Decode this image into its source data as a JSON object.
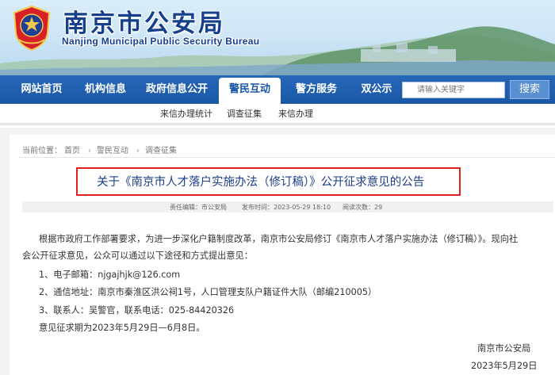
{
  "header": {
    "title_cn": "南京市公安局",
    "title_en": "Nanjing Municipal Public Security Bureau",
    "emblem_icon": "police-emblem-icon"
  },
  "nav": {
    "items": [
      {
        "label": "网站首页",
        "active": false
      },
      {
        "label": "机构信息",
        "active": false
      },
      {
        "label": "政府信息公开",
        "active": false
      },
      {
        "label": "警民互动",
        "active": true
      },
      {
        "label": "警方服务",
        "active": false
      },
      {
        "label": "双公示",
        "active": false
      }
    ],
    "search_placeholder": "请输入关键字",
    "search_button": "搜索"
  },
  "subnav": {
    "items": [
      "来信办理统计",
      "调查征集",
      "来信办理"
    ]
  },
  "breadcrumb": {
    "prefix": "当前位置：",
    "items": [
      "首页",
      "警民互动",
      "调查征集"
    ]
  },
  "article": {
    "title": "关于《南京市人才落户实施办法（修订稿）》公开征求意见的公告",
    "meta": {
      "editor": "责任编辑：市公安局",
      "published": "发布时间：2023-05-29 18:10",
      "views": "阅读次数：29"
    },
    "paragraph_line1": "根据市政府工作部署要求，为进一步深化户籍制度改革，南京市公安局修订《南京市人才落户实施办法（修订稿）》。现向社",
    "paragraph_line2": "会公开征求意见，公众可以通过以下途径和方式提出意见：",
    "item1": "1、电子邮箱：njgajhjk@126.com",
    "item2": "2、通信地址：南京市秦淮区洪公祠1号，人口管理支队户籍证件大队（邮编210005）",
    "item3": "3、联系人：吴警官，联系电话：025-84420326",
    "deadline": "意见征求期为2023年5月29日—6月8日。",
    "signature": "南京市公安局",
    "date": "2023年5月29日"
  },
  "colors": {
    "nav_blue": "#1a56a6",
    "title_blue": "#1c3f8a",
    "highlight_red": "#e02020"
  }
}
